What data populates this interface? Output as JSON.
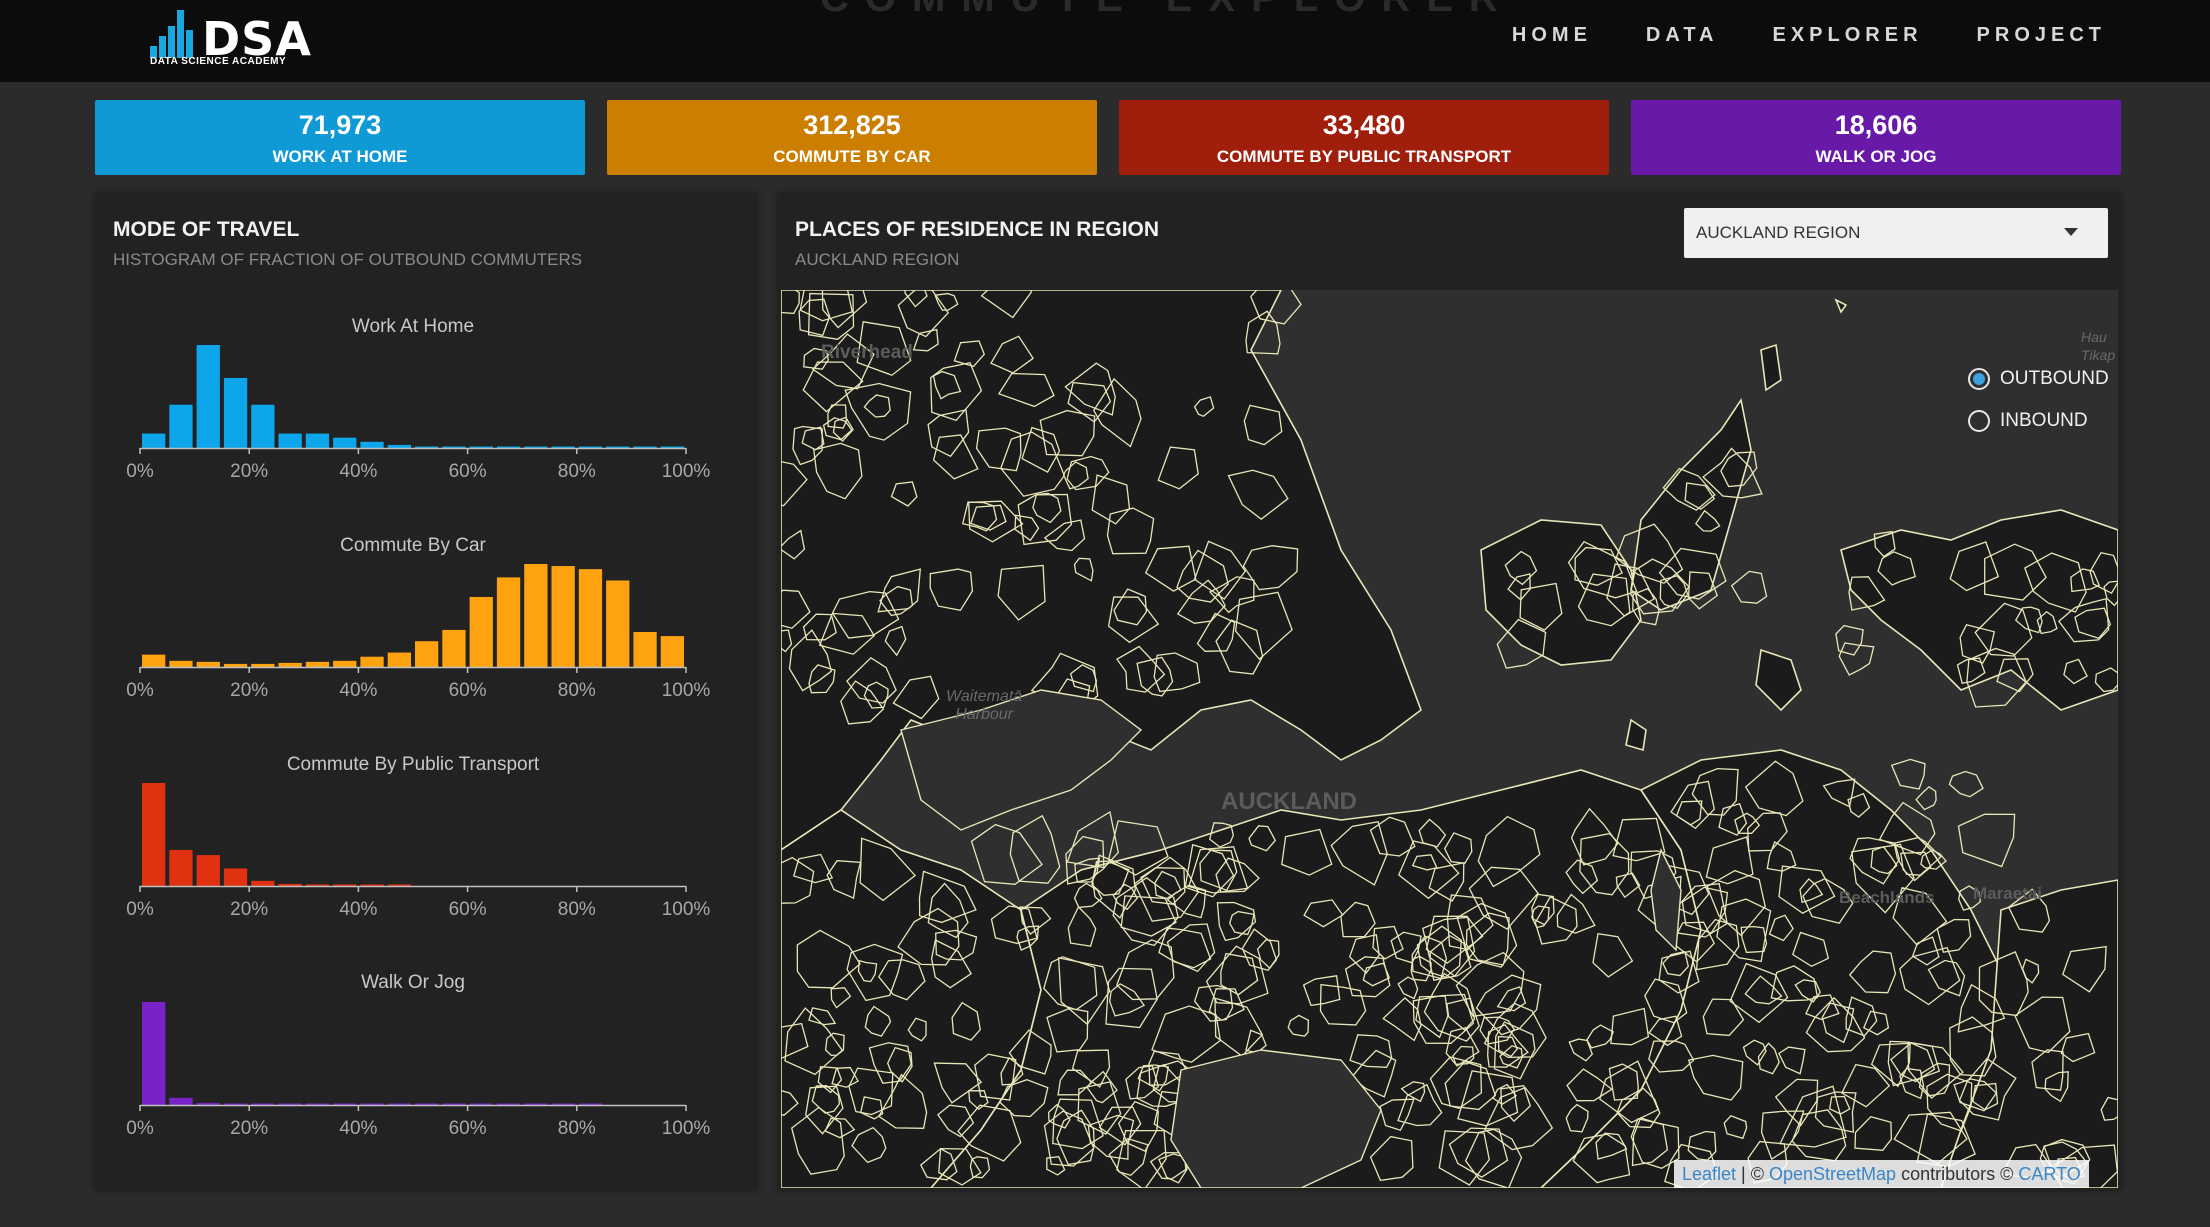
{
  "header": {
    "ghost_title": "COMMUTE EXPLORER",
    "logo_text": "DSA",
    "logo_subtitle": "DATA SCIENCE ACADEMY",
    "nav": [
      "HOME",
      "DATA",
      "EXPLORER",
      "PROJECT"
    ]
  },
  "stats": [
    {
      "value": "71,973",
      "label": "WORK AT HOME",
      "color": "#0f9ad6"
    },
    {
      "value": "312,825",
      "label": "COMMUTE BY CAR",
      "color": "#cc7e00"
    },
    {
      "value": "33,480",
      "label": "COMMUTE BY PUBLIC TRANSPORT",
      "color": "#a01e0c"
    },
    {
      "value": "18,606",
      "label": "WALK OR JOG",
      "color": "#6819a8"
    }
  ],
  "mode_panel": {
    "title": "MODE OF TRAVEL",
    "subtitle": "HISTOGRAM OF FRACTION OF OUTBOUND COMMUTERS"
  },
  "chart_data": [
    {
      "type": "bar",
      "title": "Work At Home",
      "color": "#0ea6ea",
      "x_tick_labels": [
        "0%",
        "20%",
        "40%",
        "60%",
        "80%",
        "100%"
      ],
      "xlim": [
        0,
        100
      ],
      "bin_width": 5,
      "values": [
        0.14,
        0.42,
        1.0,
        0.68,
        0.42,
        0.14,
        0.14,
        0.1,
        0.06,
        0.03,
        0.01,
        0.01,
        0.01,
        0.005,
        0.005,
        0.005,
        0.005,
        0.005,
        0.005,
        0.005
      ]
    },
    {
      "type": "bar",
      "title": "Commute By Car",
      "color": "#ffa20f",
      "x_tick_labels": [
        "0%",
        "20%",
        "40%",
        "60%",
        "80%",
        "100%"
      ],
      "xlim": [
        0,
        100
      ],
      "bin_width": 5,
      "values": [
        0.12,
        0.06,
        0.05,
        0.03,
        0.03,
        0.04,
        0.05,
        0.06,
        0.1,
        0.14,
        0.25,
        0.36,
        0.68,
        0.87,
        1.0,
        0.98,
        0.95,
        0.84,
        0.34,
        0.3
      ]
    },
    {
      "type": "bar",
      "title": "Commute By Public Transport",
      "color": "#e03111",
      "x_tick_labels": [
        "0%",
        "20%",
        "40%",
        "60%",
        "80%",
        "100%"
      ],
      "xlim": [
        0,
        100
      ],
      "bin_width": 5,
      "values": [
        1.0,
        0.35,
        0.3,
        0.17,
        0.05,
        0.02,
        0.01,
        0.005,
        0.005,
        0.005,
        0,
        0,
        0,
        0,
        0,
        0,
        0,
        0,
        0,
        0
      ]
    },
    {
      "type": "bar",
      "title": "Walk Or Jog",
      "color": "#7a22c9",
      "x_tick_labels": [
        "0%",
        "20%",
        "40%",
        "60%",
        "80%",
        "100%"
      ],
      "xlim": [
        0,
        100
      ],
      "bin_width": 5,
      "values": [
        1.0,
        0.07,
        0.02,
        0.01,
        0.005,
        0.005,
        0.005,
        0.005,
        0.005,
        0.005,
        0.005,
        0.005,
        0.005,
        0.005,
        0.005,
        0.005,
        0.005,
        0,
        0,
        0
      ]
    }
  ],
  "map_panel": {
    "title": "PLACES OF RESIDENCE IN REGION",
    "subtitle": "AUCKLAND REGION",
    "select_value": "AUCKLAND REGION",
    "labels": {
      "riverhead": "Riverhead",
      "harbour_line1": "Waitematā",
      "harbour_line2": "Harbour",
      "auckland": "AUCKLAND",
      "beachlands": "Beachlands",
      "maraetai": "Maraetai",
      "hau": "Hau",
      "tikap": "Tikap"
    },
    "radios": [
      {
        "label": "OUTBOUND",
        "checked": true
      },
      {
        "label": "INBOUND",
        "checked": false
      }
    ],
    "attribution": {
      "leaflet": "Leaflet",
      "sep": "| ©",
      "osm": "OpenStreetMap",
      "contributors": "contributors ©",
      "carto": "CARTO"
    }
  }
}
